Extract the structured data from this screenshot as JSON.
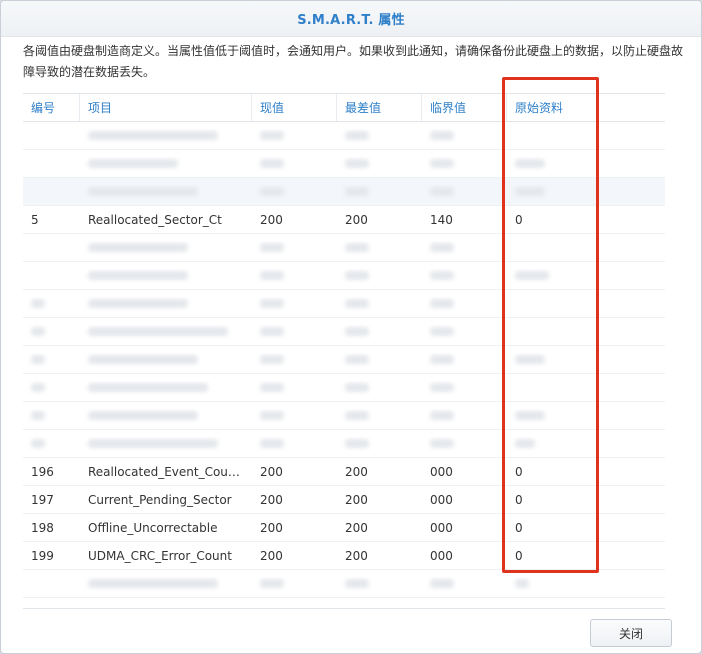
{
  "dialog": {
    "title": "S.M.A.R.T. 属性",
    "description": "各阈值由硬盘制造商定义。当属性值低于阈值时，会通知用户。如果收到此通知，请确保备份此硬盘上的数据，以防止硬盘故障导致的潜在数据丢失。",
    "close_label": "关闭"
  },
  "table": {
    "headers": [
      "编号",
      "项目",
      "现值",
      "最差值",
      "临界值",
      "原始资料"
    ],
    "visible_rows": {
      "r5": {
        "id": "5",
        "name": "Reallocated_Sector_Ct",
        "current": "200",
        "worst": "200",
        "threshold": "140",
        "raw": "0"
      },
      "r196": {
        "id": "196",
        "name": "Reallocated_Event_Cou…",
        "current": "200",
        "worst": "200",
        "threshold": "000",
        "raw": "0"
      },
      "r197": {
        "id": "197",
        "name": "Current_Pending_Sector",
        "current": "200",
        "worst": "200",
        "threshold": "000",
        "raw": "0"
      },
      "r198": {
        "id": "198",
        "name": "Offline_Uncorrectable",
        "current": "200",
        "worst": "200",
        "threshold": "000",
        "raw": "0"
      },
      "r199": {
        "id": "199",
        "name": "UDMA_CRC_Error_Count",
        "current": "200",
        "worst": "200",
        "threshold": "000",
        "raw": "0"
      }
    }
  },
  "colors": {
    "accent": "#2f7fc9",
    "highlight": "#e0331e"
  }
}
